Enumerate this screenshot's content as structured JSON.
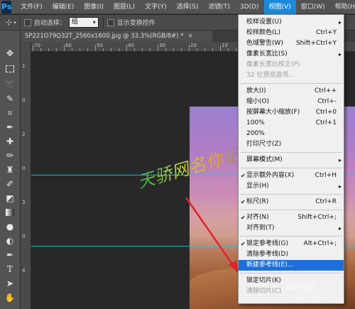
{
  "app": {
    "logo": "Ps"
  },
  "menubar": {
    "items": [
      "文件(F)",
      "编辑(E)",
      "图像(I)",
      "图层(L)",
      "文字(Y)",
      "选择(S)",
      "滤镜(T)",
      "3D(D)",
      "视图(V)",
      "窗口(W)",
      "帮助(H)"
    ],
    "active_index": 8
  },
  "options": {
    "auto_select_label": "自动选择：",
    "auto_select_value": "组",
    "show_transform_label": "显示变换控件"
  },
  "document": {
    "tab_title": "SP221O79Q32T_2560x1600.jpg @ 33.3%(RGB/8#) *",
    "close_glyph": "×"
  },
  "ruler": {
    "h_labels": [
      "70",
      "60",
      "50",
      "40",
      "30",
      "20",
      "10"
    ],
    "v_labels": [
      "1",
      "0",
      "2",
      "0",
      "3",
      "0",
      "4"
    ]
  },
  "canvas": {
    "watermark_text": "天骄网名你记着",
    "guide_color": "#00d5ff"
  },
  "view_menu": {
    "items": [
      {
        "label": "校样设置(U)",
        "shortcut": "",
        "submenu": true,
        "check": false,
        "disabled": false
      },
      {
        "label": "校样颜色(L)",
        "shortcut": "Ctrl+Y",
        "submenu": false,
        "check": false,
        "disabled": false
      },
      {
        "label": "色域警告(W)",
        "shortcut": "Shift+Ctrl+Y",
        "submenu": false,
        "check": false,
        "disabled": false
      },
      {
        "label": "像素长宽比(S)",
        "shortcut": "",
        "submenu": true,
        "check": false,
        "disabled": false
      },
      {
        "label": "像素长宽比校正(P)",
        "shortcut": "",
        "submenu": false,
        "check": false,
        "disabled": true
      },
      {
        "label": "32 位预览选项...",
        "shortcut": "",
        "submenu": false,
        "check": false,
        "disabled": true
      },
      {
        "label": "放大(I)",
        "shortcut": "Ctrl++",
        "submenu": false,
        "check": false,
        "disabled": false
      },
      {
        "label": "缩小(O)",
        "shortcut": "Ctrl+-",
        "submenu": false,
        "check": false,
        "disabled": false
      },
      {
        "label": "按屏幕大小缩放(F)",
        "shortcut": "Ctrl+0",
        "submenu": false,
        "check": false,
        "disabled": false
      },
      {
        "label": "100%",
        "shortcut": "Ctrl+1",
        "submenu": false,
        "check": false,
        "disabled": false
      },
      {
        "label": "200%",
        "shortcut": "",
        "submenu": false,
        "check": false,
        "disabled": false
      },
      {
        "label": "打印尺寸(Z)",
        "shortcut": "",
        "submenu": false,
        "check": false,
        "disabled": false
      },
      {
        "label": "屏幕模式(M)",
        "shortcut": "",
        "submenu": true,
        "check": false,
        "disabled": false
      },
      {
        "label": "显示额外内容(X)",
        "shortcut": "Ctrl+H",
        "submenu": false,
        "check": true,
        "disabled": false
      },
      {
        "label": "显示(H)",
        "shortcut": "",
        "submenu": true,
        "check": false,
        "disabled": false
      },
      {
        "label": "标尺(R)",
        "shortcut": "Ctrl+R",
        "submenu": false,
        "check": true,
        "disabled": false
      },
      {
        "label": "对齐(N)",
        "shortcut": "Shift+Ctrl+;",
        "submenu": false,
        "check": true,
        "disabled": false
      },
      {
        "label": "对齐到(T)",
        "shortcut": "",
        "submenu": true,
        "check": false,
        "disabled": false
      },
      {
        "label": "锁定参考线(G)",
        "shortcut": "Alt+Ctrl+;",
        "submenu": false,
        "check": true,
        "disabled": false
      },
      {
        "label": "清除参考线(D)",
        "shortcut": "",
        "submenu": false,
        "check": false,
        "disabled": false
      },
      {
        "label": "新建参考线(E)...",
        "shortcut": "",
        "submenu": false,
        "check": false,
        "disabled": false,
        "highlight": true
      },
      {
        "label": "锁定切片(K)",
        "shortcut": "",
        "submenu": false,
        "check": false,
        "disabled": false
      },
      {
        "label": "清除切片(C)",
        "shortcut": "",
        "submenu": false,
        "check": false,
        "disabled": true
      }
    ]
  },
  "site_watermark": {
    "text": "Bai 经验",
    "sub": "jingyan.baidu.com"
  }
}
